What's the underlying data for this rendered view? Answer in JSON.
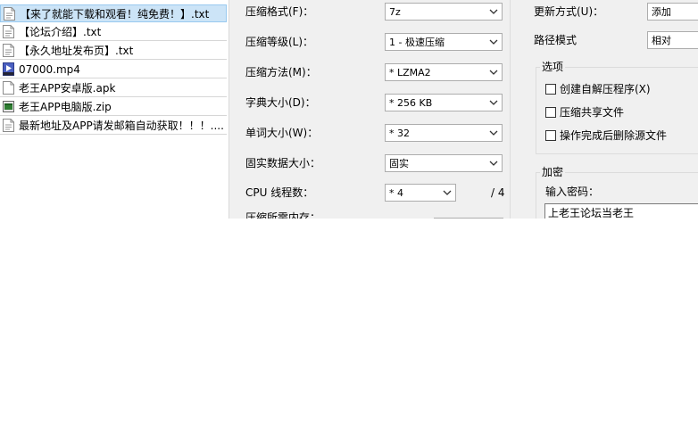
{
  "file_list": [
    {
      "name": "【来了就能下载和观看！纯免费！】.txt",
      "icon": "text-file-icon",
      "selected": true
    },
    {
      "name": "【论坛介绍】.txt",
      "icon": "text-file-icon"
    },
    {
      "name": "【永久地址发布页】.txt",
      "icon": "text-file-icon"
    },
    {
      "name": "07000.mp4",
      "icon": "video-file-icon"
    },
    {
      "name": "老王APP安卓版.apk",
      "icon": "generic-file-icon"
    },
    {
      "name": "老王APP电脑版.zip",
      "icon": "archive-file-icon"
    },
    {
      "name": "最新地址及APP请发邮箱自动获取！！！....",
      "icon": "text-file-icon"
    }
  ],
  "dialog": {
    "format_label": "压缩格式(F)：",
    "format_value": "7z",
    "level_label": "压缩等级(L)：",
    "level_value": "1 - 极速压缩",
    "method_label": "压缩方法(M)：",
    "method_value": "* LZMA2",
    "dict_label": "字典大小(D)：",
    "dict_value": "* 256 KB",
    "word_label": "单词大小(W)：",
    "word_value": "* 32",
    "solid_label": "固实数据大小：",
    "solid_value": "固实",
    "threads_label": "CPU 线程数：",
    "threads_value": "* 4",
    "threads_total": "/ 4",
    "memory_label": "压缩所需内存：",
    "update_label": "更新方式(U)：",
    "update_value": "添加",
    "path_label": "路径模式",
    "path_value": "相对",
    "options_title": "选项",
    "opt_sfx": "创建自解压程序(X)",
    "opt_shared": "压缩共享文件",
    "opt_delete": "操作完成后删除源文件",
    "encrypt_title": "加密",
    "password_label": "输入密码：",
    "password_value": "上老王论坛当老王"
  }
}
